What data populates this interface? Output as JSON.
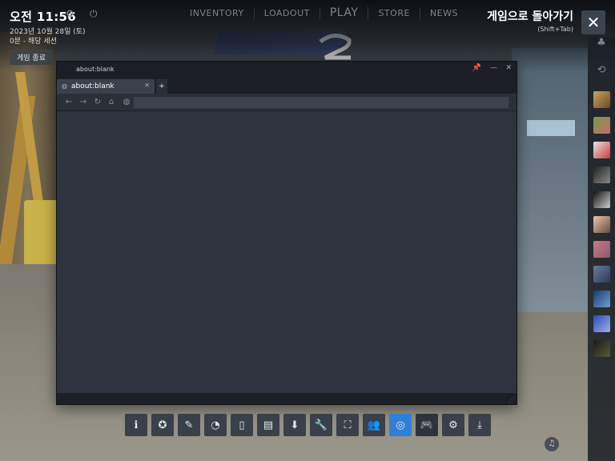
{
  "overlay": {
    "clock": "오전 11:56",
    "date": "2023년 10월 28일 (토)",
    "session": "0분 - 해당 세션",
    "end_game_label": "게임 종료",
    "return_title": "게임으로 돌아가기",
    "return_shortcut": "(Shift+Tab)"
  },
  "game_nav": {
    "items": [
      "INVENTORY",
      "LOADOUT",
      "PLAY",
      "STORE",
      "NEWS"
    ]
  },
  "browser": {
    "window_title": "about:blank",
    "tab_label": "about:blank",
    "new_tab_label": "+",
    "url_value": ""
  },
  "toolbar": {
    "items": [
      {
        "icon": "info-icon",
        "glyph": "ℹ"
      },
      {
        "icon": "achievements-icon",
        "glyph": "✪"
      },
      {
        "icon": "notes-icon",
        "glyph": "✎"
      },
      {
        "icon": "timer-icon",
        "glyph": "◔"
      },
      {
        "icon": "guides-icon",
        "glyph": "▯"
      },
      {
        "icon": "chat-icon",
        "glyph": "▤"
      },
      {
        "icon": "downloads-icon",
        "glyph": "⬇"
      },
      {
        "icon": "settings-wrench-icon",
        "glyph": "🔧"
      },
      {
        "icon": "screenshot-icon",
        "glyph": "⛶"
      },
      {
        "icon": "friends-icon",
        "glyph": "👥"
      },
      {
        "icon": "browser-icon",
        "glyph": "◎"
      },
      {
        "icon": "controller-icon",
        "glyph": "🎮"
      },
      {
        "icon": "gear-icon",
        "glyph": "⚙"
      },
      {
        "icon": "minimize-overlay-icon",
        "glyph": "⤓"
      }
    ]
  },
  "colors": {
    "accent": "#2f7fd8",
    "browser_bg": "#2e333d"
  }
}
